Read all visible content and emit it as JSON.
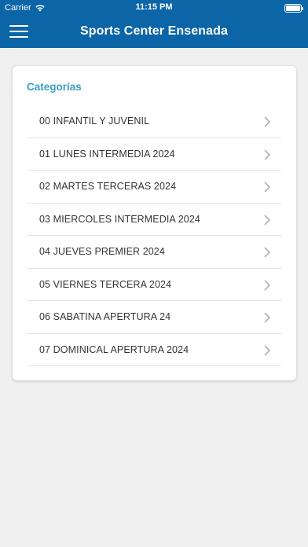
{
  "status": {
    "carrier": "Carrier",
    "time": "11:15 PM"
  },
  "nav": {
    "title": "Sports Center Ensenada"
  },
  "card": {
    "heading": "Categorías",
    "items": [
      {
        "label": "00 INFANTIL Y JUVENIL"
      },
      {
        "label": "01 LUNES INTERMEDIA 2024"
      },
      {
        "label": "02 MARTES TERCERAS 2024"
      },
      {
        "label": "03 MIERCOLES INTERMEDIA 2024"
      },
      {
        "label": "04 JUEVES PREMIER 2024"
      },
      {
        "label": "05 VIERNES TERCERA 2024"
      },
      {
        "label": "06 SABATINA APERTURA 24"
      },
      {
        "label": "07 DOMINICAL APERTURA 2024"
      }
    ]
  },
  "colors": {
    "primary": "#0b65a7",
    "heading": "#3a9fc6",
    "background": "#f0f0f0"
  },
  "icons": {
    "menu": "hamburger-menu-icon",
    "row": "chevron-right-icon",
    "wifi": "wifi-icon",
    "battery": "battery-icon"
  }
}
